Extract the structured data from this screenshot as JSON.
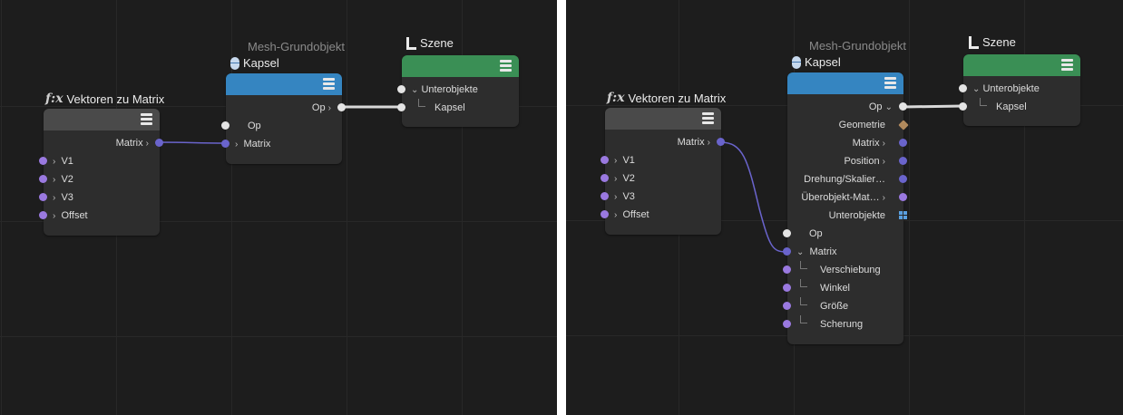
{
  "left": {
    "vektoren": {
      "title": "Vektoren zu Matrix",
      "out_port": "Matrix",
      "inputs": [
        "V1",
        "V2",
        "V3",
        "Offset"
      ]
    },
    "kapsel": {
      "subtitle": "Mesh-Grundobjekt",
      "title": "Kapsel",
      "out_port": "Op",
      "in_op": "Op",
      "in_matrix": "Matrix"
    },
    "szene": {
      "title": "Szene",
      "children_label": "Unterobjekte",
      "child": "Kapsel"
    }
  },
  "right": {
    "vektoren": {
      "title": "Vektoren zu Matrix",
      "out_port": "Matrix",
      "inputs": [
        "V1",
        "V2",
        "V3",
        "Offset"
      ]
    },
    "kapsel": {
      "subtitle": "Mesh-Grundobjekt",
      "title": "Kapsel",
      "outputs": [
        "Op",
        "Geometrie",
        "Matrix",
        "Position",
        "Drehung/Skalier…",
        "Überobjekt-Mat…",
        "Unterobjekte"
      ],
      "in_op": "Op",
      "in_matrix": "Matrix",
      "matrix_children": [
        "Verschiebung",
        "Winkel",
        "Größe",
        "Scherung"
      ]
    },
    "szene": {
      "title": "Szene",
      "children_label": "Unterobjekte",
      "child": "Kapsel"
    }
  },
  "colors": {
    "background": "#1d1d1d",
    "node_body": "#2d2d2d",
    "header_gray": "#4a4a4a",
    "header_blue": "#3585c1",
    "header_green": "#3a8f55",
    "port_purple": "#9a79e0",
    "port_blue": "#6a64cc"
  }
}
